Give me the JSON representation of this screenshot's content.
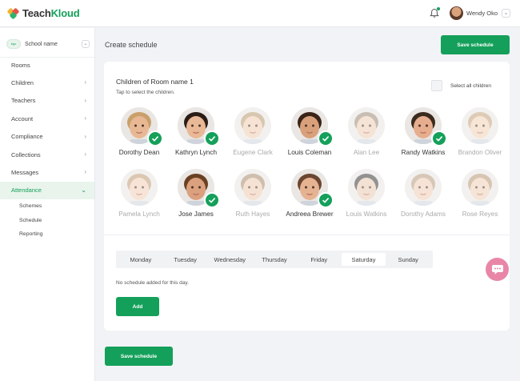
{
  "app": {
    "brand_a": "Teach",
    "brand_b": "Kloud"
  },
  "user": {
    "name": "Wendy Oko"
  },
  "sidebar": {
    "school_logo": "logo",
    "school_name": "School name",
    "items": [
      {
        "label": "Rooms",
        "chevron": false
      },
      {
        "label": "Children",
        "chevron": true
      },
      {
        "label": "Teachers",
        "chevron": true
      },
      {
        "label": "Account",
        "chevron": true
      },
      {
        "label": "Compliance",
        "chevron": true
      },
      {
        "label": "Collections",
        "chevron": true
      },
      {
        "label": "Messages",
        "chevron": true
      },
      {
        "label": "Attendance",
        "chevron": true,
        "active": true
      }
    ],
    "sub_items": [
      "Schemes",
      "Schedule",
      "Reporting"
    ]
  },
  "header": {
    "title": "Create schedule",
    "save_label": "Save schedule"
  },
  "room": {
    "title": "Children of Room name 1",
    "subtitle": "Tap to select the children.",
    "select_all_label": "Select all children"
  },
  "children": [
    {
      "name": "Dorothy Dean",
      "selected": true,
      "skin": "#e8b894",
      "hair": "#c9a06a"
    },
    {
      "name": "Kathryn Lynch",
      "selected": true,
      "skin": "#e9b896",
      "hair": "#2b1d16"
    },
    {
      "name": "Eugene Clark",
      "selected": false,
      "skin": "#f0cdb0",
      "hair": "#b89a70"
    },
    {
      "name": "Louis Coleman",
      "selected": true,
      "skin": "#d9a07c",
      "hair": "#3a2418"
    },
    {
      "name": "Alan Lee",
      "selected": false,
      "skin": "#eecfb4",
      "hair": "#9c8a76"
    },
    {
      "name": "Randy Watkins",
      "selected": true,
      "skin": "#e6ad8e",
      "hair": "#3b2a1e"
    },
    {
      "name": "Brandon Oliver",
      "selected": false,
      "skin": "#f1d1b6",
      "hair": "#c4a27c"
    },
    {
      "name": "Pamela Lynch",
      "selected": false,
      "skin": "#f1cfb6",
      "hair": "#c09a74"
    },
    {
      "name": "Jose James",
      "selected": true,
      "skin": "#dba07e",
      "hair": "#6a4022"
    },
    {
      "name": "Ruth Hayes",
      "selected": false,
      "skin": "#efcbb0",
      "hair": "#a88a6c"
    },
    {
      "name": "Andreea Brewer",
      "selected": true,
      "skin": "#e6b392",
      "hair": "#6b4630"
    },
    {
      "name": "Louis Watkins",
      "selected": false,
      "skin": "#eacbb2",
      "hair": "#3a3a3a"
    },
    {
      "name": "Dorothy Adams",
      "selected": false,
      "skin": "#f0cdb4",
      "hair": "#b59a80"
    },
    {
      "name": "Rose Reyes",
      "selected": false,
      "skin": "#f0cfb6",
      "hair": "#b89674"
    }
  ],
  "schedule": {
    "days": [
      "Monday",
      "Tuesday",
      "Wednesday",
      "Thursday",
      "Friday",
      "Saturday",
      "Sunday"
    ],
    "active_day": "Saturday",
    "empty_message": "No schedule added for this day.",
    "add_label": "Add"
  },
  "colors": {
    "accent": "#14a05a",
    "chat": "#e986a8"
  }
}
